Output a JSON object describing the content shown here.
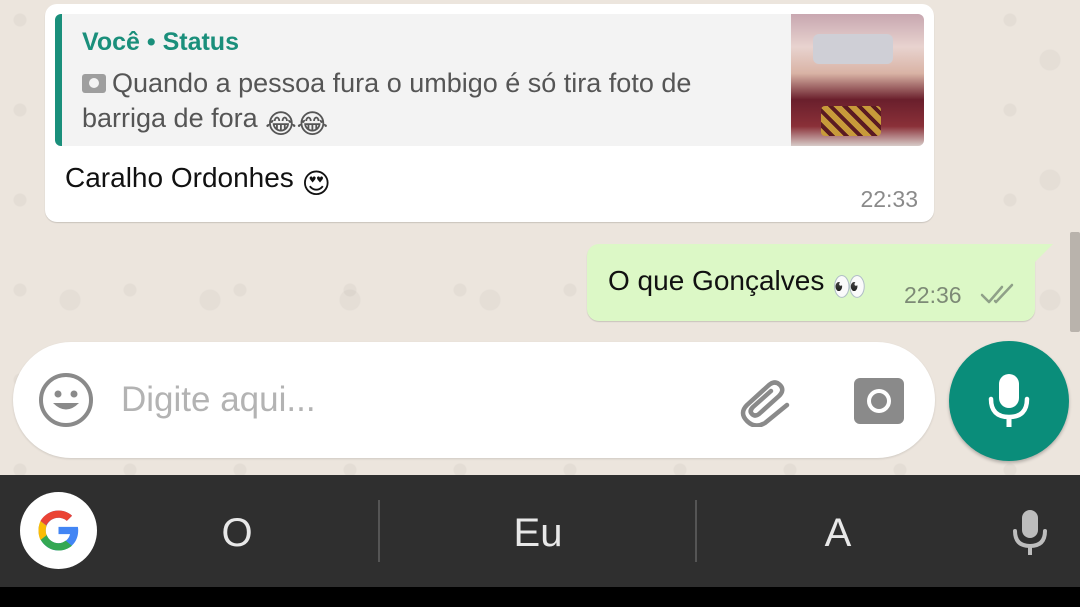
{
  "chat": {
    "incoming": {
      "quote_author": "Você",
      "quote_separator": "•",
      "quote_source": "Status",
      "quote_text": "Quando a pessoa fura o umbigo é só tira foto de barriga de fora",
      "quote_emoji": "😂😂",
      "text": "Caralho Ordonhes",
      "emoji": "😍",
      "time": "22:33"
    },
    "outgoing": {
      "text": "O que Gonçalves",
      "emoji": "👀",
      "time": "22:36",
      "status_icon": "double-check-icon"
    }
  },
  "composer": {
    "placeholder": "Digite aqui...",
    "value": "",
    "emoji_icon": "smiley-icon",
    "attach_icon": "paperclip-icon",
    "camera_icon": "camera-icon",
    "send_icon": "microphone-icon"
  },
  "keyboard": {
    "suggestions": [
      "O",
      "Eu",
      "A"
    ],
    "google_icon": "google-g-icon",
    "voice_icon": "microphone-icon"
  },
  "colors": {
    "accent": "#0a8d7a",
    "quote_bar": "#1a8f7b",
    "outgoing_bubble": "#dcf8c6",
    "incoming_bubble": "#ffffff",
    "chat_background": "#ece5dd",
    "keyboard_bar": "#2f2f2f"
  }
}
